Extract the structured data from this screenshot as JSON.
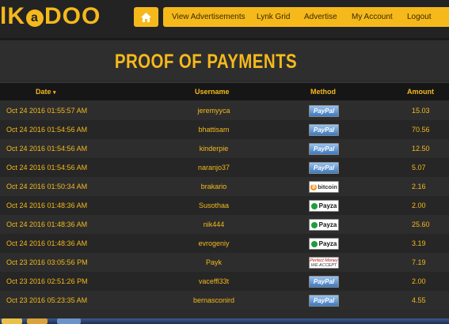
{
  "logo": {
    "left": "lK",
    "circle": "a",
    "right": "DOO"
  },
  "nav": {
    "home_icon": "home-icon",
    "items": [
      "View Advertisements",
      "Lynk Grid",
      "Advertise",
      "My Account",
      "Logout"
    ]
  },
  "page": {
    "title": "PROOF OF PAYMENTS"
  },
  "table": {
    "headers": {
      "date": "Date",
      "date_sort_icon": "▾",
      "username": "Username",
      "method": "Method",
      "amount": "Amount"
    },
    "rows": [
      {
        "date": "Oct 24 2016 01:55:57 AM",
        "username": "jeremyyca",
        "method": "PayPal",
        "amount": "15.03"
      },
      {
        "date": "Oct 24 2016 01:54:56 AM",
        "username": "bhattisam",
        "method": "PayPal",
        "amount": "70.56"
      },
      {
        "date": "Oct 24 2016 01:54:56 AM",
        "username": "kinderpie",
        "method": "PayPal",
        "amount": "12.50"
      },
      {
        "date": "Oct 24 2016 01:54:56 AM",
        "username": "naranjo37",
        "method": "PayPal",
        "amount": "5.07"
      },
      {
        "date": "Oct 24 2016 01:50:34 AM",
        "username": "brakario",
        "method": "bitcoin",
        "amount": "2.16"
      },
      {
        "date": "Oct 24 2016 01:48:36 AM",
        "username": "Susothaa",
        "method": "Payza",
        "amount": "2.00"
      },
      {
        "date": "Oct 24 2016 01:48:36 AM",
        "username": "nik444",
        "method": "Payza",
        "amount": "25.60"
      },
      {
        "date": "Oct 24 2016 01:48:36 AM",
        "username": "evrogeniy",
        "method": "Payza",
        "amount": "3.19"
      },
      {
        "date": "Oct 23 2016 03:05:56 PM",
        "username": "Payk",
        "method": "Perfect Money",
        "amount": "7.19"
      },
      {
        "date": "Oct 23 2016 02:51:26 PM",
        "username": "vaceffl33t",
        "method": "PayPal",
        "amount": "2.00"
      },
      {
        "date": "Oct 23 2016 05:23:35 AM",
        "username": "bernasconird",
        "method": "PayPal",
        "amount": "4.55"
      }
    ]
  },
  "badges": {
    "pm_line1": "Perfect Money",
    "pm_line2": "WE ACCEPT"
  },
  "colors": {
    "accent": "#f5b91c",
    "background": "#2b2b2b",
    "header_bg": "#161616"
  }
}
